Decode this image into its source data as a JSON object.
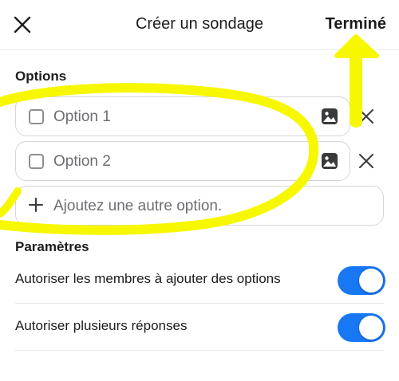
{
  "header": {
    "title": "Créer un sondage",
    "done_label": "Terminé"
  },
  "options_section": {
    "title": "Options",
    "items": [
      {
        "label": "Option 1"
      },
      {
        "label": "Option 2"
      }
    ],
    "add_label": "Ajoutez une autre option."
  },
  "settings_section": {
    "title": "Paramètres",
    "items": [
      {
        "label": "Autoriser les membres à ajouter des options",
        "enabled": true
      },
      {
        "label": "Autoriser plusieurs réponses",
        "enabled": true
      }
    ]
  },
  "colors": {
    "accent": "#1877f2",
    "annotation": "#f7f700",
    "text": "#1c1c1e",
    "placeholder": "#6e6e73"
  },
  "icons": {
    "close": "close-icon",
    "image": "image-icon",
    "remove": "remove-icon",
    "add": "plus-icon"
  }
}
